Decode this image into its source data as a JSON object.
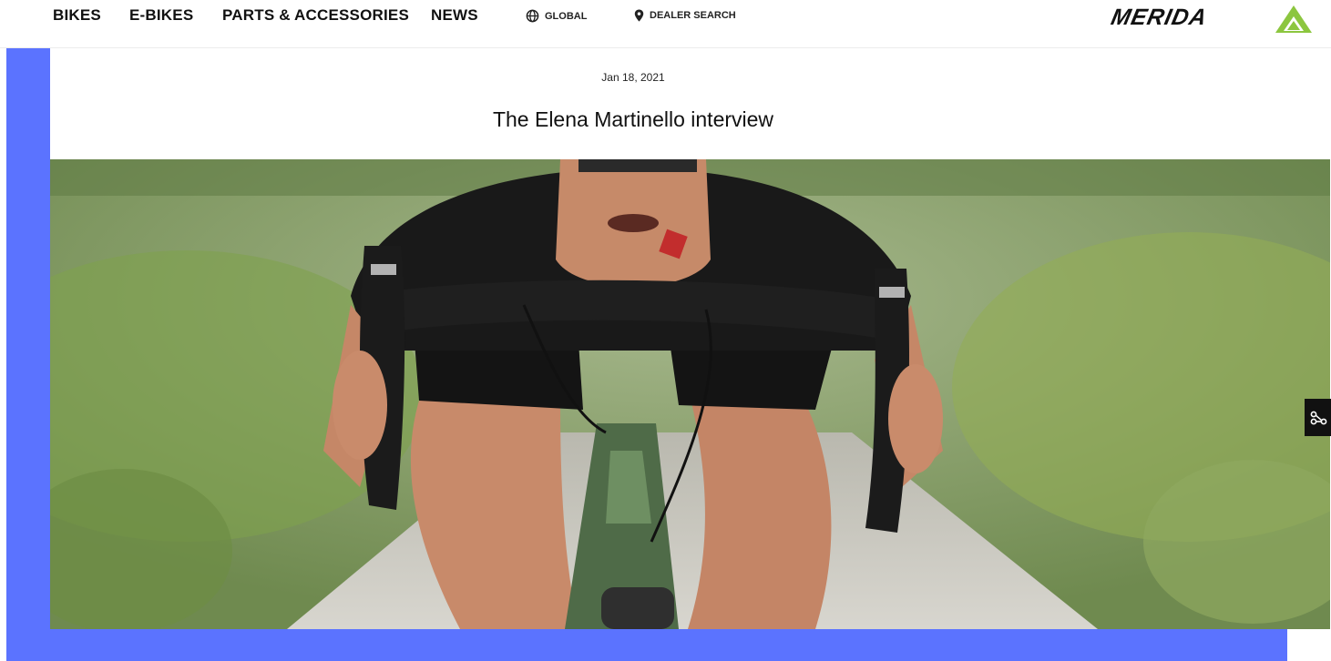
{
  "nav": {
    "items": [
      "BIKES",
      "E-BIKES",
      "PARTS & ACCESSORIES",
      "NEWS"
    ],
    "global_label": "GLOBAL",
    "dealer_label": "DEALER SEARCH",
    "logo_text": "MERIDA"
  },
  "article": {
    "date": "Jan 18, 2021",
    "title": "The Elena Martinello interview"
  },
  "colors": {
    "frame": "#5b73ff",
    "logo_green": "#8cc63f",
    "text": "#111111"
  },
  "icons": {
    "global": "globe-icon",
    "dealer": "map-pin-icon",
    "share": "share-icon"
  }
}
